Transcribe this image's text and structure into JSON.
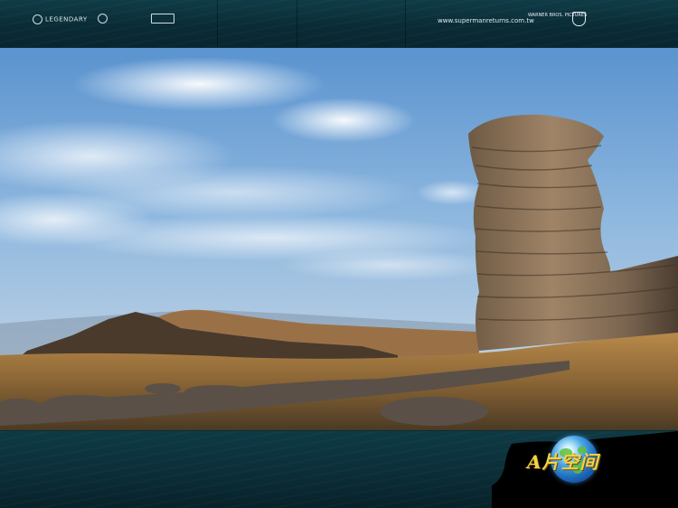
{
  "header": {
    "logo_legendary": "LEGENDARY",
    "logo_second": "",
    "site_url": "www.supermanreturns.com.tw",
    "studio_credit": "WARNER BROS. PICTURES"
  },
  "footer": {
    "brand_text": "A片空间"
  },
  "colors": {
    "sea": "#0b2f39",
    "sky": "#6fa8dc",
    "brand_gold": "#f2d14a"
  },
  "icons": {
    "header_left": [
      "legendary-logo-icon",
      "circle-logo-icon",
      "square-logo-icon"
    ],
    "header_right": [
      "warner-bros-shield-icon"
    ],
    "footer": [
      "globe-icon"
    ]
  }
}
